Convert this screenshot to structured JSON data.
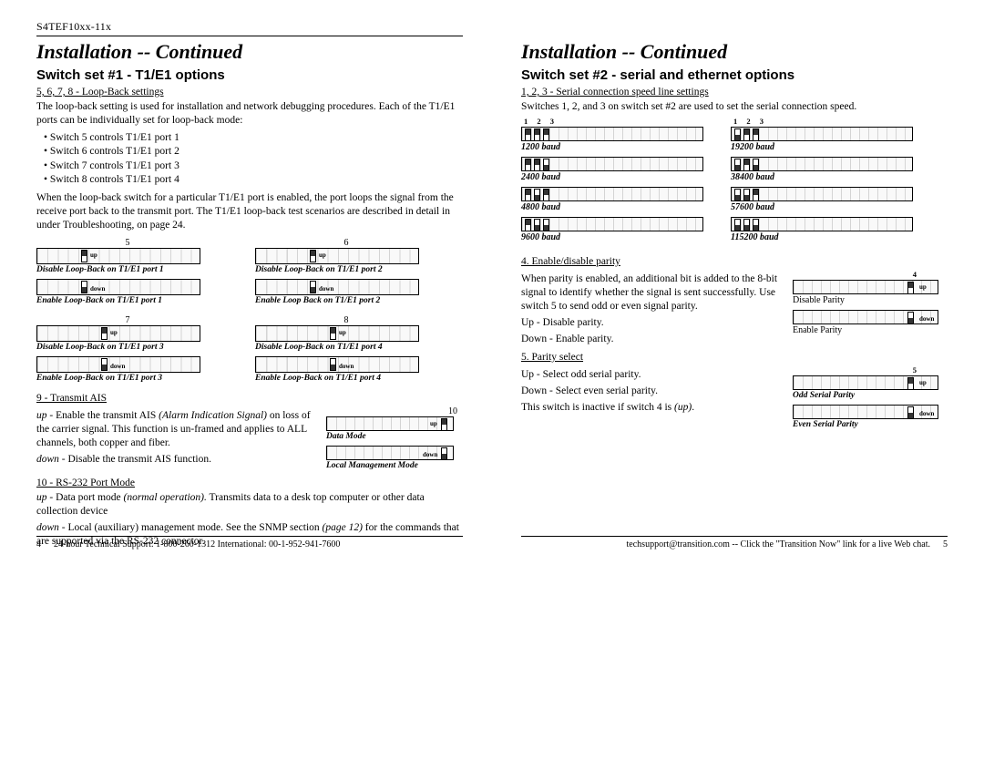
{
  "doc_id": "S4TEF10xx-11x",
  "page_left_num": "4",
  "page_right_num": "5",
  "footer_left": "24-hour Technical Support: 1-800-260-1312  International: 00-1-952-941-7600",
  "footer_right": "techsupport@transition.com -- Click the \"Transition Now\" link for a live Web chat.",
  "title_left": "Installation -- Continued",
  "title_right": "Installation -- Continued",
  "left": {
    "heading": "Switch set #1 - T1/E1 options",
    "loopback_head": "5, 6, 7, 8 - Loop-Back settings",
    "loopback_intro": "The loop-back setting is used for installation and network debugging procedures. Each of the T1/E1 ports can be individually set for loop-back mode:",
    "bullets": [
      "Switch 5 controls T1/E1 port 1",
      "Switch 6 controls T1/E1 port 2",
      "Switch 7 controls T1/E1 port 3",
      "Switch 8 controls T1/E1 port 4"
    ],
    "loopback_note": "When the loop-back switch for a particular T1/E1 port is enabled, the port loops the signal from the receive port back to the transmit port. The T1/E1 loop-back test scenarios are described in detail in under Troubleshooting, on page 24.",
    "dipset12": [
      {
        "num": "5",
        "disable": "Disable Loop-Back on T1/E1 port 1",
        "enable": "Enable Loop-Back on T1/E1 port 1",
        "slot": 4
      },
      {
        "num": "6",
        "disable": "Disable Loop-Back on T1/E1 port 2",
        "enable": "Enable Loop Back on T1/E1 port 2",
        "slot": 5
      }
    ],
    "dipset34": [
      {
        "num": "7",
        "disable": "Disable Loop-Back on T1/E1 port 3",
        "enable": "Enable Loop-Back on T1/E1 port 3",
        "slot": 6
      },
      {
        "num": "8",
        "disable": "Disable Loop-Back on T1/E1 port 4",
        "enable": "Enable Loop-Back on T1/E1 port 4",
        "slot": 7
      }
    ],
    "ais_head": "9 - Transmit AIS",
    "ais_up_lead": "up",
    "ais_up_text": " - Enable the transmit AIS ",
    "ais_up_ital": "(Alarm Indication Signal)",
    "ais_up_text2": " on loss of the carrier signal. This function is un-framed and applies to ALL channels, both copper and fiber.",
    "ais_down_lead": "down",
    "ais_down_text": " - Disable the transmit AIS function.",
    "rs232_head": "10 - RS-232 Port Mode",
    "rs232_up_lead": "up",
    "rs232_up_text": " - Data port mode ",
    "rs232_up_ital": "(normal operation).",
    "rs232_up_text2": " Transmits data to a desk top computer or other data collection device",
    "rs232_down_lead": "down",
    "rs232_down_text": " -  Local (auxiliary) management mode. See the SNMP section ",
    "rs232_down_ital": "(page 12)",
    "rs232_down_text2": " for the commands that are supported via the RS-232 connector.",
    "dip10num": "10",
    "dip10_data": "Data Mode",
    "dip10_local": "Local Management Mode"
  },
  "right": {
    "heading": "Switch set #2 - serial and ethernet options",
    "serial_head": "1, 2, 3 - Serial connection speed line settings",
    "serial_intro": "Switches 1, 2, and 3 on switch set #2 are used to set the serial connection speed.",
    "numhead": "1  2  3",
    "baud_left": [
      {
        "label": "1200 baud",
        "pattern": "UUU"
      },
      {
        "label": "2400 baud",
        "pattern": "UUD"
      },
      {
        "label": "4800 baud",
        "pattern": "UDU"
      },
      {
        "label": "9600 baud",
        "pattern": "UDD"
      }
    ],
    "baud_right": [
      {
        "label": "19200 baud",
        "pattern": "DUU"
      },
      {
        "label": "38400 baud",
        "pattern": "DUD"
      },
      {
        "label": "57600 baud",
        "pattern": "DDU"
      },
      {
        "label": "115200 baud",
        "pattern": "DDD"
      }
    ],
    "parity_head": "4.  Enable/disable parity",
    "parity_text": "When parity is enabled, an additional bit is added to the 8-bit signal to identify whether the signal is sent successfully. Use switch 5 to send odd or even signal parity.",
    "parity_up": "Up - Disable parity.",
    "parity_down": "Down - Enable parity.",
    "parity_num": "4",
    "parity_disable": "Disable Parity",
    "parity_enable": "Enable Parity",
    "sel_head": "5.  Parity select",
    "sel_up": "Up - Select odd serial parity.",
    "sel_down": "Down - Select even serial parity.",
    "sel_note_a": "This switch is inactive if switch 4 is ",
    "sel_note_ital": "(up)",
    "sel_note_b": ".",
    "sel_num": "5",
    "sel_odd": "Odd Serial Parity",
    "sel_even": "Even Serial Parity"
  },
  "labels": {
    "up": "up",
    "down": "down"
  }
}
